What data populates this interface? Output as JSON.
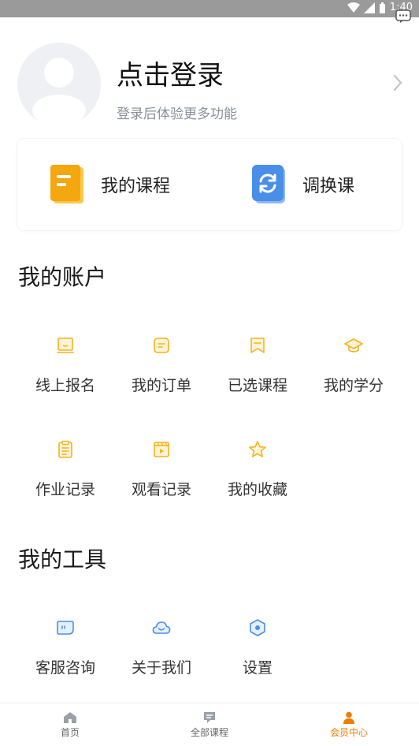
{
  "status_bar": {
    "time": "1:40"
  },
  "profile": {
    "title": "点击登录",
    "subtitle": "登录后体验更多功能"
  },
  "quick": [
    {
      "label": "我的课程",
      "icon": "course-book-icon"
    },
    {
      "label": "调换课",
      "icon": "swap-course-icon"
    }
  ],
  "account": {
    "title": "我的账户",
    "items": [
      {
        "label": "线上报名",
        "icon": "online-signup-icon"
      },
      {
        "label": "我的订单",
        "icon": "order-icon"
      },
      {
        "label": "已选课程",
        "icon": "bookmark-icon"
      },
      {
        "label": "我的学分",
        "icon": "graduation-cap-icon"
      },
      {
        "label": "作业记录",
        "icon": "clipboard-icon"
      },
      {
        "label": "观看记录",
        "icon": "video-icon"
      },
      {
        "label": "我的收藏",
        "icon": "star-icon"
      }
    ]
  },
  "tools": {
    "title": "我的工具",
    "items": [
      {
        "label": "客服咨询",
        "icon": "chat-bubble-icon"
      },
      {
        "label": "关于我们",
        "icon": "cloud-icon"
      },
      {
        "label": "设置",
        "icon": "settings-hexagon-icon"
      }
    ]
  },
  "tabbar": {
    "items": [
      {
        "label": "首页",
        "icon": "home-icon"
      },
      {
        "label": "全部课程",
        "icon": "courses-icon"
      },
      {
        "label": "会员中心",
        "icon": "member-icon"
      }
    ],
    "active_index": 2
  },
  "colors": {
    "accent": "#f07d00",
    "icon_yellow": "#f5b21f",
    "tool_blue": "#4a8fe7",
    "inactive": "#9aa0a8"
  }
}
